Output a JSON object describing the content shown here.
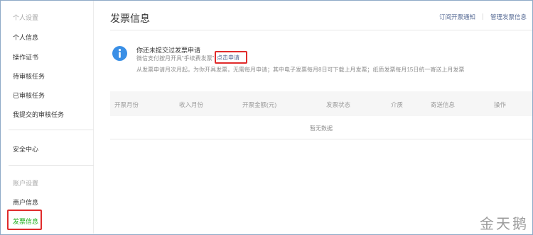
{
  "sidebar": {
    "group_personal": "个人设置",
    "items_personal": [
      "个人信息",
      "操作证书",
      "待审核任务",
      "已审核任务",
      "我提交的审核任务"
    ],
    "security": "安全中心",
    "group_account": "账户设置",
    "merchant_info": "商户信息",
    "invoice_info": "发票信息"
  },
  "header": {
    "title": "发票信息",
    "link_subscribe": "订阅开票通知",
    "link_manage": "管理发票信息"
  },
  "notice": {
    "icon": "info-icon",
    "title": "你还未提交过发票申请",
    "line1": "微信支付按月开具“手续费发票”",
    "apply_link": "点击申请",
    "line2": "从发票申请月次月起，为你开具发票，无需每月申请；其中电子发票每月8日可下载上月发票；纸质发票每月15日统一寄送上月发票"
  },
  "table": {
    "columns": [
      "开票月份",
      "收入月份",
      "开票金额(元)",
      "发票状态",
      "介质",
      "寄送信息",
      "操作"
    ],
    "empty": "暂无数据"
  },
  "watermark": "金天鹅",
  "colors": {
    "accent_green": "#1aad19",
    "link_blue": "#576b95",
    "info_blue": "#3a8fe6",
    "highlight_red": "#e02b2b"
  }
}
